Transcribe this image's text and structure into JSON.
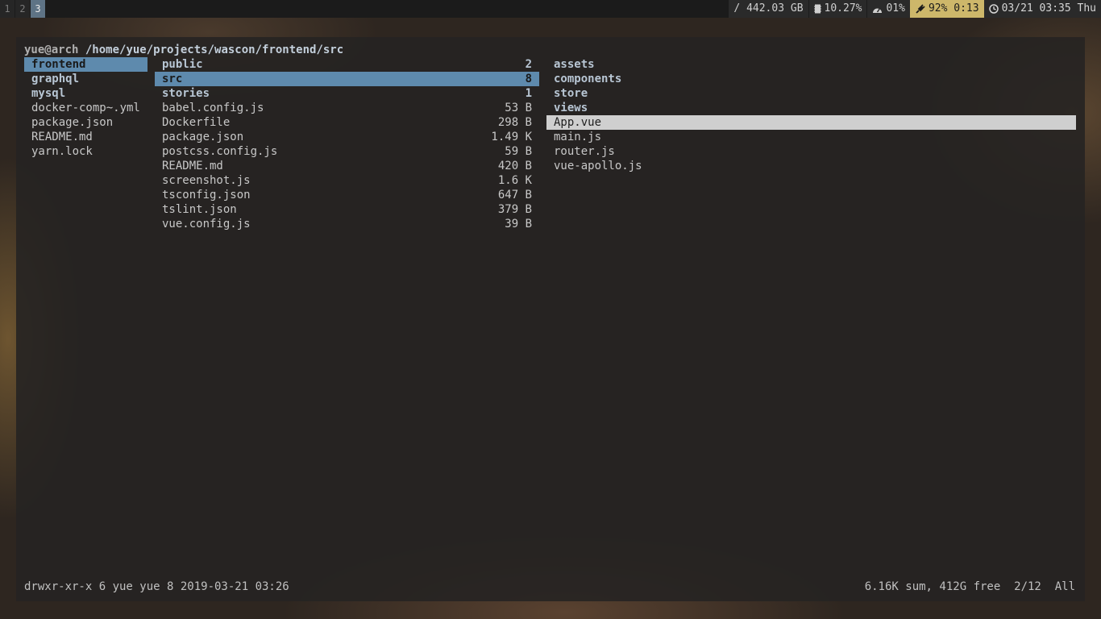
{
  "workspaces": [
    {
      "label": "1",
      "active": false
    },
    {
      "label": "2",
      "active": false
    },
    {
      "label": "3",
      "active": true
    }
  ],
  "status": {
    "disk": "/ 442.03 GB",
    "mem": "10.27%",
    "cpu": "01%",
    "battery": "92% 0:13",
    "clock": "03/21 03:35 Thu"
  },
  "icons": {
    "memory": "memory-icon",
    "cpu": "speedometer-icon",
    "battery": "plug-icon",
    "clock": "clock-icon"
  },
  "colors": {
    "selected_dir": "#5e8aad",
    "selected_file": "#cfcfcf",
    "battery_bg": "#cdb76a",
    "active_workspace": "#5e7385"
  },
  "ranger": {
    "user": "yue@arch",
    "path": "/home/yue/projects/wascon/frontend/src",
    "parent": [
      {
        "name": "frontend",
        "type": "dir",
        "selected": true
      },
      {
        "name": "graphql",
        "type": "dir"
      },
      {
        "name": "mysql",
        "type": "dir"
      },
      {
        "name": "docker-comp~.yml",
        "type": "file"
      },
      {
        "name": "package.json",
        "type": "file"
      },
      {
        "name": "README.md",
        "type": "file"
      },
      {
        "name": "yarn.lock",
        "type": "file"
      }
    ],
    "current": [
      {
        "name": "public",
        "type": "dir",
        "size": "2"
      },
      {
        "name": "src",
        "type": "dir",
        "size": "8",
        "selected": true
      },
      {
        "name": "stories",
        "type": "dir",
        "size": "1"
      },
      {
        "name": "babel.config.js",
        "type": "file",
        "size": "53 B"
      },
      {
        "name": "Dockerfile",
        "type": "file",
        "size": "298 B"
      },
      {
        "name": "package.json",
        "type": "file",
        "size": "1.49 K"
      },
      {
        "name": "postcss.config.js",
        "type": "file",
        "size": "59 B"
      },
      {
        "name": "README.md",
        "type": "file",
        "size": "420 B"
      },
      {
        "name": "screenshot.js",
        "type": "file",
        "size": "1.6 K"
      },
      {
        "name": "tsconfig.json",
        "type": "file",
        "size": "647 B"
      },
      {
        "name": "tslint.json",
        "type": "file",
        "size": "379 B"
      },
      {
        "name": "vue.config.js",
        "type": "file",
        "size": "39 B"
      }
    ],
    "preview": [
      {
        "name": "assets",
        "type": "dir"
      },
      {
        "name": "components",
        "type": "dir"
      },
      {
        "name": "store",
        "type": "dir"
      },
      {
        "name": "views",
        "type": "dir"
      },
      {
        "name": "App.vue",
        "type": "file",
        "selected": true
      },
      {
        "name": "main.js",
        "type": "file"
      },
      {
        "name": "router.js",
        "type": "file"
      },
      {
        "name": "vue-apollo.js",
        "type": "file"
      }
    ],
    "status_left": "drwxr-xr-x 6 yue yue 8 2019-03-21 03:26",
    "status_right": "6.16K sum, 412G free  2/12  All"
  }
}
